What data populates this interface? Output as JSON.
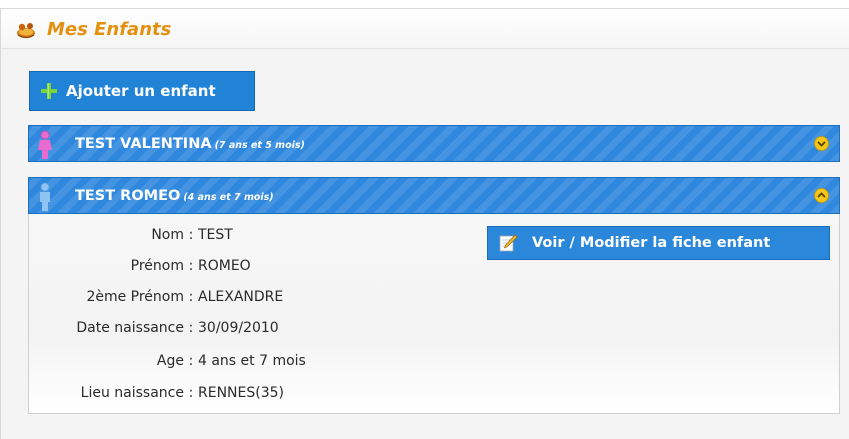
{
  "panel": {
    "title": "Mes Enfants",
    "icon": "children-icon"
  },
  "add_button": {
    "icon": "plus-icon",
    "label": "Ajouter un enfant"
  },
  "children": [
    {
      "name": "TEST VALENTINA",
      "age": "(7 ans et 5 mois)",
      "avatar_icon": "girl-icon",
      "toggle_icon": "expand-icon",
      "expanded": false
    },
    {
      "name": "TEST ROMEO",
      "age": "(4 ans et 7 mois)",
      "avatar_icon": "boy-icon",
      "toggle_icon": "collapse-icon",
      "expanded": true,
      "details": [
        {
          "label": "Nom",
          "value": "TEST"
        },
        {
          "label": "Prénom",
          "value": "ROMEO"
        },
        {
          "label": "2ème Prénom",
          "value": "ALEXANDRE"
        },
        {
          "label": "Date naissance",
          "value": "30/09/2010"
        },
        {
          "label": "Age",
          "value": "4 ans et 7 mois"
        },
        {
          "label": "Lieu naissance",
          "value": "RENNES(35)"
        }
      ],
      "edit_button": {
        "icon": "edit-icon",
        "label": "Voir / Modifier la fiche enfant"
      }
    }
  ],
  "separator": ":",
  "colors": {
    "title_orange": "#e4900f",
    "button_blue": "#2083d6",
    "bar_blue": "#2f88de",
    "toggle_yellow": "#f5c518"
  }
}
